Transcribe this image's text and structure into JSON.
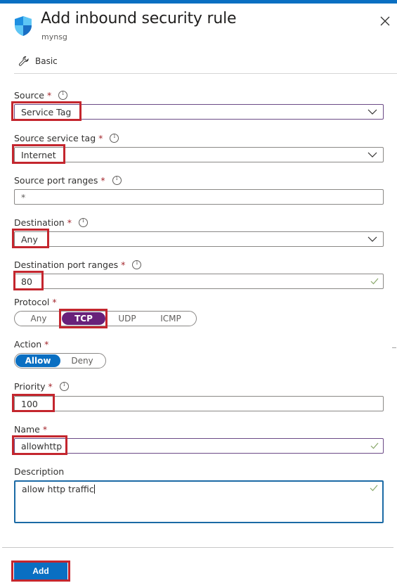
{
  "header": {
    "title": "Add inbound security rule",
    "subtitle": "mynsg",
    "icon": "shield-icon",
    "close_icon": "close-icon"
  },
  "tabs": [
    {
      "label": "Basic",
      "icon": "wrench-icon"
    }
  ],
  "form": {
    "source": {
      "label": "Source",
      "required": "*",
      "value": "Service Tag",
      "type": "dropdown"
    },
    "source_service_tag": {
      "label": "Source service tag",
      "required": "*",
      "value": "Internet",
      "type": "dropdown"
    },
    "source_port_ranges": {
      "label": "Source port ranges",
      "required": "*",
      "value": "*",
      "type": "text"
    },
    "destination": {
      "label": "Destination",
      "required": "*",
      "value": "Any",
      "type": "dropdown"
    },
    "destination_port_ranges": {
      "label": "Destination port ranges",
      "required": "*",
      "value": "80",
      "type": "text",
      "valid": true
    },
    "protocol": {
      "label": "Protocol",
      "required": "*",
      "options": [
        "Any",
        "TCP",
        "UDP",
        "ICMP"
      ],
      "selected": "TCP"
    },
    "action": {
      "label": "Action",
      "required": "*",
      "options": [
        "Allow",
        "Deny"
      ],
      "selected": "Allow"
    },
    "priority": {
      "label": "Priority",
      "required": "*",
      "value": "100",
      "type": "text"
    },
    "name": {
      "label": "Name",
      "required": "*",
      "value": "allowhttp",
      "type": "text",
      "valid": true
    },
    "description": {
      "label": "Description",
      "value": "allow http traffic",
      "type": "textarea",
      "valid": true
    }
  },
  "footer": {
    "add_label": "Add"
  },
  "colors": {
    "accent_blue": "#0a6fc2",
    "protocol_selected": "#68217a",
    "highlight_red": "#c4262e",
    "required_red": "#a4262c",
    "valid_check": "#8aa86b"
  }
}
